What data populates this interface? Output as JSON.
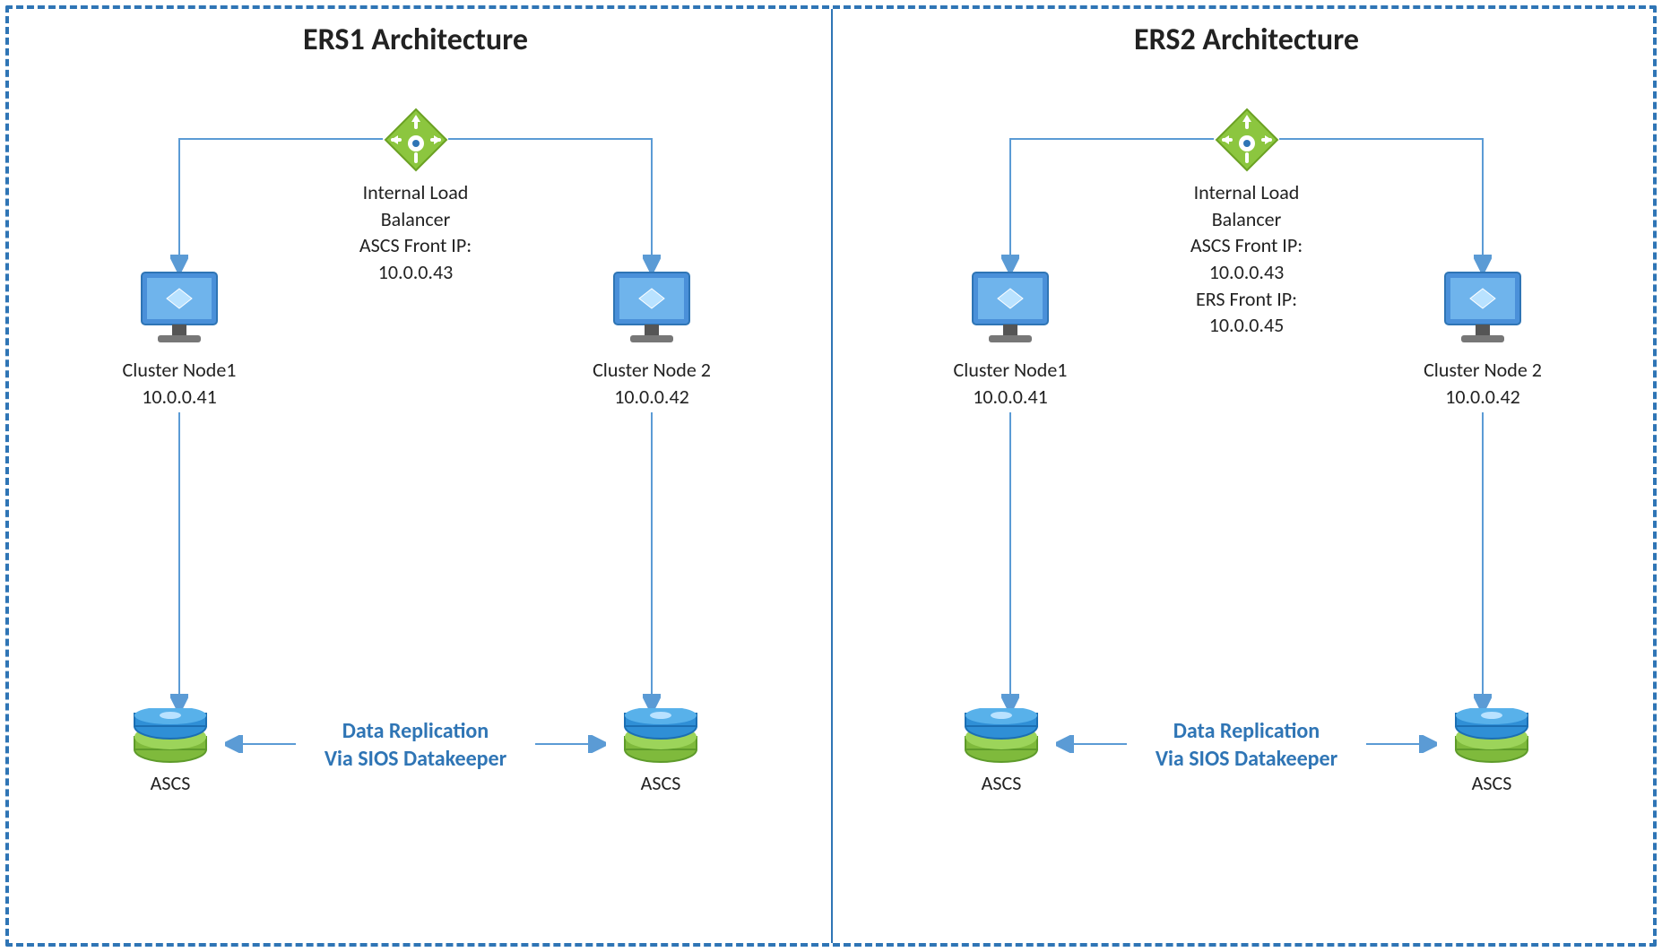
{
  "panels": [
    {
      "title": "ERS1 Architecture",
      "lb_text": "Internal Load\nBalancer\nASCS Front IP:\n10.0.0.43",
      "node1_name": "Cluster Node1",
      "node1_ip": "10.0.0.41",
      "node2_name": "Cluster Node 2",
      "node2_ip": "10.0.0.42",
      "replication_line1": "Data Replication",
      "replication_line2": "Via SIOS Datakeeper",
      "disk1_label": "ASCS",
      "disk2_label": "ASCS"
    },
    {
      "title": "ERS2 Architecture",
      "lb_text": "Internal Load\nBalancer\nASCS Front IP:\n10.0.0.43\nERS Front IP:\n10.0.0.45",
      "node1_name": "Cluster Node1",
      "node1_ip": "10.0.0.41",
      "node2_name": "Cluster Node 2",
      "node2_ip": "10.0.0.42",
      "replication_line1": "Data Replication",
      "replication_line2": "Via SIOS Datakeeper",
      "disk1_label": "ASCS",
      "disk2_label": "ASCS"
    }
  ]
}
